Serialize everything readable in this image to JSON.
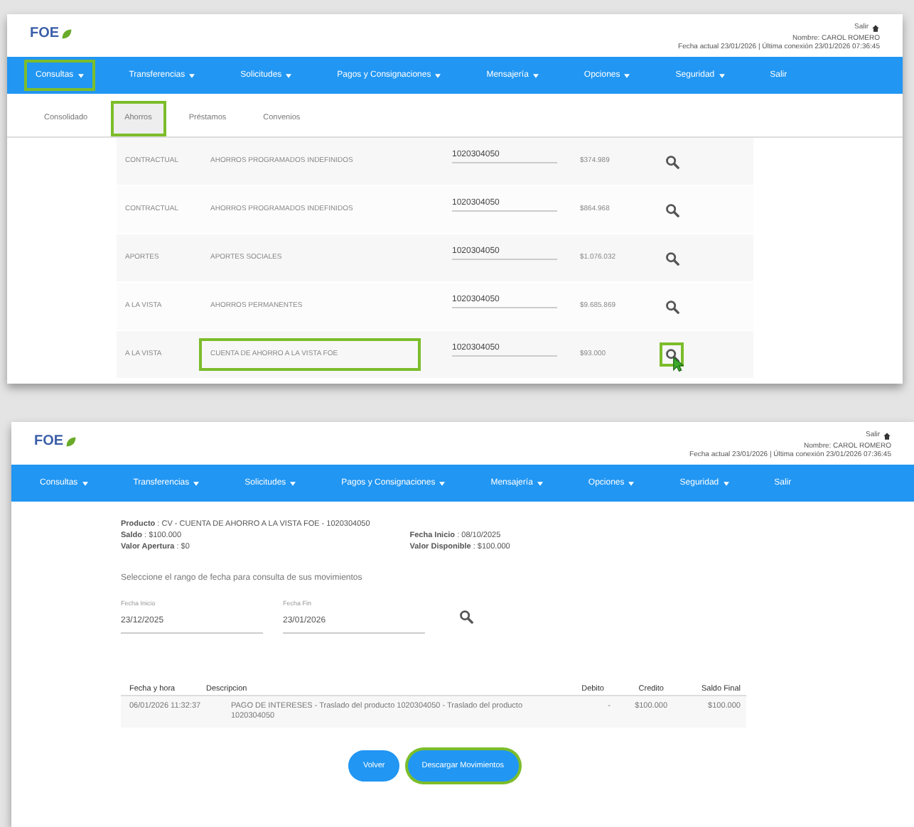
{
  "screens": [
    {
      "header": {
        "logo": "FOE",
        "user": "Nombre: CAROL ROMERO",
        "dates": "Fecha actual 23/01/2026 | Última conexión 23/01/2026 07:36:45",
        "exit": "Salir"
      },
      "nav": [
        {
          "label": "Consultas",
          "caret": true,
          "highlighted": true
        },
        {
          "label": "Transferencias",
          "caret": true,
          "highlighted": false
        },
        {
          "label": "Solicitudes",
          "caret": true,
          "highlighted": false
        },
        {
          "label": "Pagos y Consignaciones",
          "caret": true,
          "highlighted": false
        },
        {
          "label": "Mensajería",
          "caret": true,
          "highlighted": false
        },
        {
          "label": "Opciones",
          "caret": true,
          "highlighted": false
        },
        {
          "label": "Seguridad",
          "caret": true,
          "highlighted": false
        },
        {
          "label": "Salir",
          "caret": false,
          "highlighted": false
        }
      ],
      "tabs": [
        {
          "label": "Consolidado",
          "selected": false,
          "highlighted": false
        },
        {
          "label": "Ahorros",
          "selected": true,
          "highlighted": true
        },
        {
          "label": "Préstamos",
          "selected": false,
          "highlighted": false
        },
        {
          "label": "Convenios",
          "selected": false,
          "highlighted": false
        }
      ],
      "rows": [
        {
          "type": "CONTRACTUAL",
          "description": "AHORROS PROGRAMADOS INDEFINIDOS",
          "number": "1020304050",
          "balance": "$374.989",
          "highlighted": false
        },
        {
          "type": "CONTRACTUAL",
          "description": "AHORROS PROGRAMADOS INDEFINIDOS",
          "number": "1020304050",
          "balance": "$864.968",
          "highlighted": false
        },
        {
          "type": "APORTES",
          "description": "APORTES SOCIALES",
          "number": "1020304050",
          "balance": "$1.076.032",
          "highlighted": false
        },
        {
          "type": "A LA VISTA",
          "description": "AHORROS PERMANENTES",
          "number": "1020304050",
          "balance": "$9.685.869",
          "highlighted": false
        },
        {
          "type": "A LA VISTA",
          "description": "CUENTA DE AHORRO A LA VISTA FOE",
          "number": "1020304050",
          "balance": "$93.000",
          "highlighted": true
        }
      ]
    },
    {
      "header": {
        "logo": "FOE",
        "user": "Nombre: CAROL ROMERO",
        "dates": "Fecha actual 23/01/2026 | Última conexión 23/01/2026 07:36:45",
        "exit": "Salir"
      },
      "nav": [
        {
          "label": "Consultas",
          "caret": true,
          "highlighted": false
        },
        {
          "label": "Transferencias",
          "caret": true,
          "highlighted": false
        },
        {
          "label": "Solicitudes",
          "caret": true,
          "highlighted": false
        },
        {
          "label": "Pagos y Consignaciones",
          "caret": true,
          "highlighted": false
        },
        {
          "label": "Mensajería",
          "caret": true,
          "highlighted": false
        },
        {
          "label": "Opciones",
          "caret": true,
          "highlighted": false
        },
        {
          "label": "Seguridad",
          "caret": true,
          "highlighted": false
        },
        {
          "label": "Salir",
          "caret": false,
          "highlighted": false
        }
      ],
      "details": [
        [
          "**Producto** : CV - CUENTA DE AHORRO A LA VISTA FOE - 1020304050",
          "**Saldo** : $100.000",
          "**Valor Apertura** : $0"
        ],
        [
          "**Fecha Inicio** : 08/10/2025",
          "**Valor Disponible** : $100.000"
        ]
      ],
      "prompt": "Seleccione el rango de fecha para consulta de sus movimientos",
      "fields": [
        {
          "label": "Fecha Inicio",
          "value": "23/12/2025"
        },
        {
          "label": "Fecha Fin",
          "value": "23/01/2026"
        }
      ],
      "columns": [
        "Fecha y hora",
        "Descripcion",
        "Debito",
        "Credito",
        "Saldo Final"
      ],
      "movements": [
        {
          "date": "06/01/2026 11:32:37",
          "description": "PAGO DE INTERESES - Traslado del producto 1020304050 - Traslado del producto 1020304050",
          "debit": "-",
          "credit": "$100.000",
          "balance": "$100.000"
        }
      ],
      "buttons": [
        {
          "label": "Volver",
          "highlighted": false
        },
        {
          "label": "Descargar Movimientos",
          "highlighted": true
        }
      ]
    }
  ]
}
